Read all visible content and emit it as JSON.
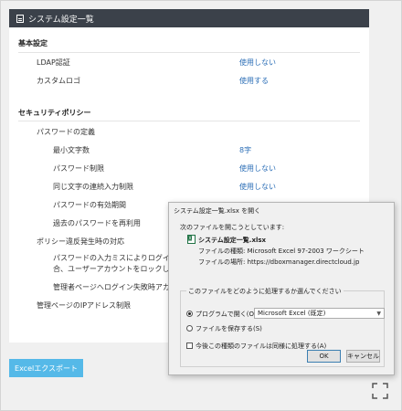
{
  "panel": {
    "title": "システム設定一覧"
  },
  "basic": {
    "title": "基本設定",
    "items": [
      {
        "label": "LDAP認証",
        "value": "使用しない"
      },
      {
        "label": "カスタムロゴ",
        "value": "使用する"
      }
    ]
  },
  "security": {
    "title": "セキュリティポリシー",
    "password_def": "パスワードの定義",
    "password_items": [
      {
        "label": "最小文字数",
        "value": "8字"
      },
      {
        "label": "パスワード制限",
        "value": "使用しない"
      },
      {
        "label": "同じ文字の連続入力制限",
        "value": "使用しない"
      },
      {
        "label": "パスワードの有効期間"
      },
      {
        "label": "過去のパスワードを再利用"
      }
    ],
    "violation": "ポリシー違反発生時の対応",
    "violation_items": [
      {
        "line1": "パスワードの入力ミスによりログインに",
        "line2": "合、ユーザーアカウントをロックします"
      },
      {
        "line1": "管理者ページへログイン失敗時アカウン"
      }
    ],
    "admin_ip": "管理ページのIPアドレス制限"
  },
  "excel_button": "Excelエクスポート",
  "icons": {
    "doc": "document-icon",
    "expand": "expand-icon",
    "excel": "excel-file-icon"
  },
  "dialog": {
    "title": "システム設定一覧.xlsx を開く",
    "prompt": "次のファイルを開こうとしています:",
    "filename": "システム設定一覧.xlsx",
    "type_label": "ファイルの種類: Microsoft Excel 97-2003 ワークシート",
    "location_label": "ファイルの場所: https://dboxmanager.directcloud.jp",
    "group_title": "このファイルをどのように処理するか選んでください",
    "open_with_label": "プログラムで開く(O):",
    "open_with_value": "Microsoft Excel (既定)",
    "save_label": "ファイルを保存する(S)",
    "remember_label": "今後この種類のファイルは同様に処理する(A)",
    "ok": "OK",
    "cancel": "キャンセル"
  },
  "colors": {
    "header_bg": "#3b414a",
    "link": "#2a6db6",
    "excel_button": "#55b9e8"
  }
}
